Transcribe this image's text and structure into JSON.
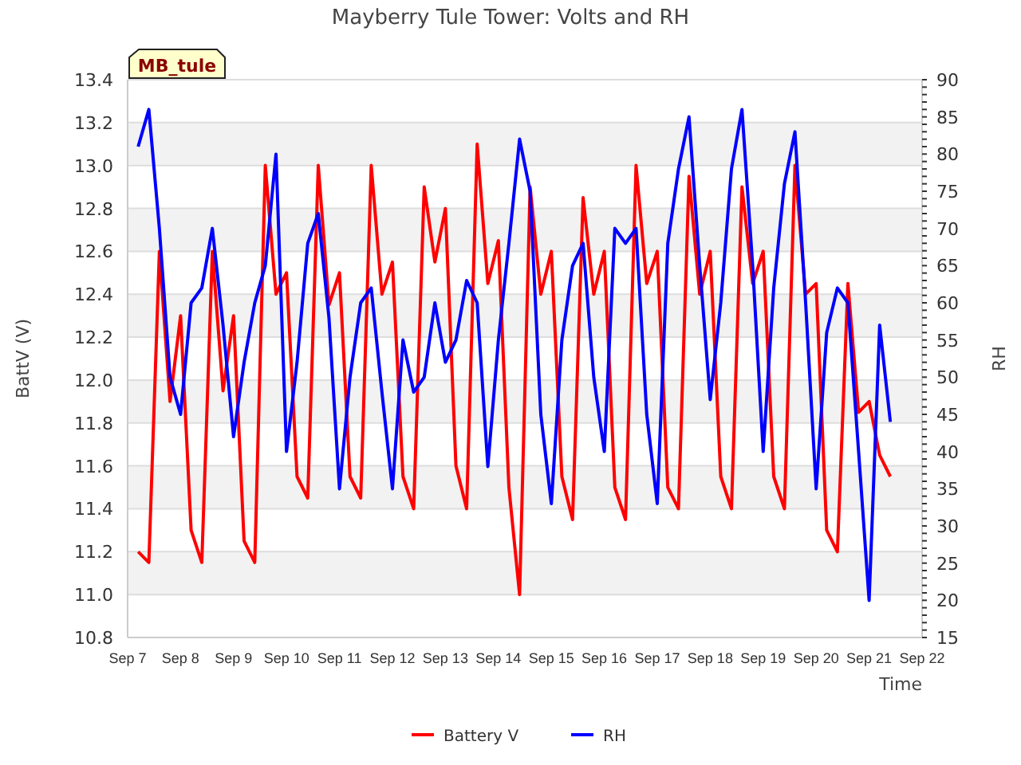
{
  "site_label": "MB_tule",
  "chart_data": {
    "type": "line",
    "title": "Mayberry Tule Tower: Volts and RH",
    "xlabel": "Time",
    "ylabel": "BattV (V)",
    "y2label": "RH",
    "categories": [
      "Sep 7",
      null,
      null,
      null,
      null,
      "Sep 8",
      null,
      null,
      null,
      null,
      "Sep 9",
      null,
      null,
      null,
      null,
      "Sep 10",
      null,
      null,
      null,
      null,
      "Sep 11",
      null,
      null,
      null,
      null,
      "Sep 12",
      null,
      null,
      null,
      null,
      "Sep 13",
      null,
      null,
      null,
      null,
      "Sep 14",
      null,
      null,
      null,
      null,
      "Sep 15",
      null,
      null,
      null,
      null,
      "Sep 16",
      null,
      null,
      null,
      null,
      "Sep 17",
      null,
      null,
      null,
      null,
      "Sep 18",
      null,
      null,
      null,
      null,
      "Sep 19",
      null,
      null,
      null,
      null,
      "Sep 20",
      null,
      null,
      null,
      null,
      "Sep 21",
      null,
      null,
      null,
      null,
      "Sep 22"
    ],
    "series": [
      {
        "name": "Battery V",
        "color": "#ff0000",
        "axis": "y",
        "values": [
          null,
          11.2,
          11.15,
          12.6,
          11.9,
          12.3,
          11.3,
          11.15,
          12.6,
          11.95,
          12.3,
          11.25,
          11.15,
          13.0,
          12.4,
          12.5,
          11.55,
          11.45,
          13.0,
          12.35,
          12.5,
          11.55,
          11.45,
          13.0,
          12.4,
          12.55,
          11.55,
          11.4,
          12.9,
          12.55,
          12.8,
          11.6,
          11.4,
          13.1,
          12.45,
          12.65,
          11.5,
          11.0,
          12.9,
          12.4,
          12.6,
          11.55,
          11.35,
          12.85,
          12.4,
          12.6,
          11.5,
          11.35,
          13.0,
          12.45,
          12.6,
          11.5,
          11.4,
          12.95,
          12.4,
          12.6,
          11.55,
          11.4,
          12.9,
          12.45,
          12.6,
          11.55,
          11.4,
          13.0,
          12.4,
          12.45,
          11.3,
          11.2,
          12.45,
          11.85,
          11.9,
          11.65,
          11.55,
          null,
          null,
          null
        ]
      },
      {
        "name": "RH",
        "color": "#0000ff",
        "axis": "y2",
        "values": [
          null,
          81,
          86,
          70,
          50,
          45,
          60,
          62,
          70,
          57,
          42,
          52,
          60,
          65,
          80,
          40,
          52,
          68,
          72,
          58,
          35,
          50,
          60,
          62,
          48,
          35,
          55,
          48,
          50,
          60,
          52,
          55,
          63,
          60,
          38,
          55,
          68,
          82,
          75,
          45,
          33,
          55,
          65,
          68,
          50,
          40,
          70,
          68,
          70,
          45,
          33,
          68,
          78,
          85,
          65,
          47,
          60,
          78,
          86,
          65,
          40,
          62,
          76,
          83,
          60,
          35,
          56,
          62,
          60,
          40,
          20,
          57,
          44,
          null,
          null,
          null
        ]
      }
    ],
    "grid": true,
    "legend": "bottom",
    "ylim": [
      10.8,
      13.4
    ],
    "y2lim": [
      15,
      90
    ],
    "yticks": [
      {
        "value": 10.8,
        "label": "10.8"
      },
      {
        "value": 11.0,
        "label": "11.0"
      },
      {
        "value": 11.2,
        "label": "11.2"
      },
      {
        "value": 11.4,
        "label": "11.4"
      },
      {
        "value": 11.6,
        "label": "11.6"
      },
      {
        "value": 11.8,
        "label": "11.8"
      },
      {
        "value": 12.0,
        "label": "12.0"
      },
      {
        "value": 12.2,
        "label": "12.2"
      },
      {
        "value": 12.4,
        "label": "12.4"
      },
      {
        "value": 12.6,
        "label": "12.6"
      },
      {
        "value": 12.8,
        "label": "12.8"
      },
      {
        "value": 13.0,
        "label": "13.0"
      },
      {
        "value": 13.2,
        "label": "13.2"
      },
      {
        "value": 13.4,
        "label": "13.4"
      }
    ],
    "y2ticks": [
      15,
      20,
      25,
      30,
      35,
      40,
      45,
      50,
      55,
      60,
      65,
      70,
      75,
      80,
      85,
      90
    ]
  }
}
